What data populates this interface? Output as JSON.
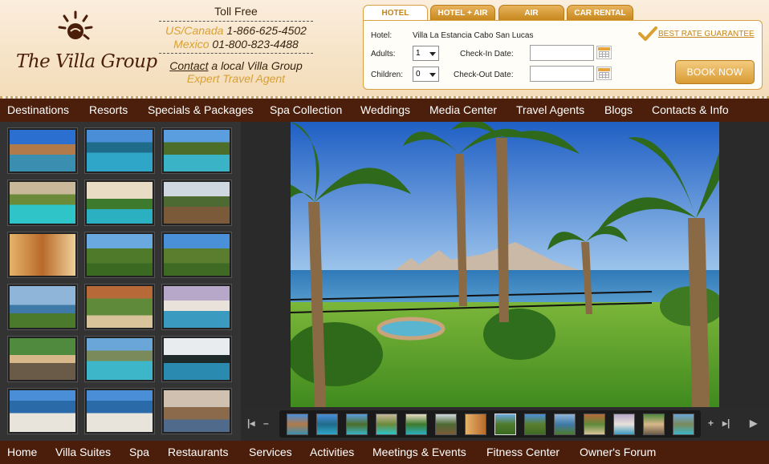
{
  "header": {
    "logo_text": "The Villa Group",
    "toll_free": {
      "title": "Toll Free",
      "lines": [
        {
          "region": "US/Canada",
          "number": "1-866-625-4502"
        },
        {
          "region": "Mexico",
          "number": "01-800-823-4488"
        }
      ],
      "contact_link": "Contact",
      "contact_rest": " a local Villa Group",
      "agent_text": "Expert Travel Agent"
    }
  },
  "booking": {
    "tabs": [
      "HOTEL",
      "HOTEL + AIR",
      "AIR",
      "CAR RENTAL"
    ],
    "active_tab": "HOTEL",
    "hotel_label": "Hotel:",
    "hotel_value": "Villa La Estancia Cabo San Lucas",
    "adults_label": "Adults:",
    "adults_value": "1",
    "children_label": "Children:",
    "children_value": "0",
    "checkin_label": "Check-In Date:",
    "checkout_label": "Check-Out Date:",
    "best_rate": "BEST RATE GUARANTEE",
    "book_now": "BOOK NOW"
  },
  "nav_top": [
    "Destinations",
    "Resorts",
    "Specials & Packages",
    "Spa Collection",
    "Weddings",
    "Media Center",
    "Travel Agents",
    "Blogs",
    "Contacts & Info"
  ],
  "nav_bottom": [
    "Home",
    "Villa Suites",
    "Spa",
    "Restaurants",
    "Services",
    "Activities",
    "Meetings & Events",
    "Fitness Center",
    "Owner's Forum"
  ],
  "gallery": {
    "thumbnail_count": 18,
    "filmstrip_count": 14,
    "selected_filmstrip_index": 7,
    "icons": [
      "first-icon",
      "minus-icon",
      "plus-icon",
      "last-icon",
      "play-icon"
    ]
  },
  "colors": {
    "nav_bg": "#4b1f0b",
    "accent": "#d9a032",
    "header_bg": "#f6e4c6"
  }
}
